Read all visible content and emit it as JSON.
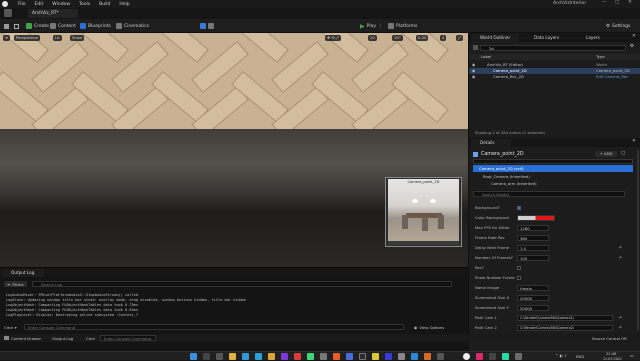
{
  "titlebar": {
    "menu": [
      "File",
      "Edit",
      "Window",
      "Tools",
      "Build",
      "Help"
    ],
    "project": "ArchVizInterior",
    "doc_tab": "ArchViz_RT*"
  },
  "toolbar": {
    "create": "Create",
    "content": "Content",
    "blueprints": "Blueprints",
    "cinematics": "Cinematics",
    "play": "Play",
    "platforms": "Platforms",
    "settings": "Settings"
  },
  "viewport": {
    "perspective": "Perspective",
    "lit": "Lit",
    "show": "Show",
    "grid_snap": "10",
    "rot_snap": "10°",
    "scale_snap": "0.25",
    "cam_speed": "4",
    "preview_label": "Camera_point_2D"
  },
  "outliner": {
    "tab_label": "World Outliner",
    "tab_data_layers": "Data Layers",
    "tab_layers": "Layers",
    "search_value": "2d",
    "col_label": "Label",
    "col_type": "Type",
    "rows": [
      {
        "label": "ArchViz_RT (Editor)",
        "type": "World"
      },
      {
        "label": "Camera_point_2D",
        "type": "Camera_point_2D"
      },
      {
        "label": "Camera_Rec_2D",
        "type": "Edit Camera_Rec"
      }
    ],
    "status": "Showing 2 of 284 actors (1 selected)"
  },
  "details": {
    "tab": "Details",
    "object_name": "Camera_point_2D",
    "add_label": "+ ADD",
    "self_row": "Camera_point_2D (self)",
    "root_component": "Root_Camera (Inherited)",
    "arm_component": "Camera_arm (Inherited)",
    "search_placeholder": "Search Details",
    "props": [
      {
        "label": "Background?",
        "value": ""
      },
      {
        "label": "Color Background",
        "value": ""
      },
      {
        "label": "Max FPS for Editor",
        "value": "1260"
      },
      {
        "label": "Frame Rate Rec",
        "value": "360"
      },
      {
        "label": "Delay Next Frame",
        "value": "1.0"
      },
      {
        "label": "Number Of Frames?",
        "value": "100"
      },
      {
        "label": "Rec?",
        "value": ""
      },
      {
        "label": "Show Number Frame",
        "value": ""
      },
      {
        "label": "Name Image",
        "value": "Vmain"
      },
      {
        "label": "Screenshot Size X",
        "value": "20000"
      },
      {
        "label": "Screenshot Size Y",
        "value": "20000"
      },
      {
        "label": "Path Cam 1",
        "value": "C:\\Render\\Camera360\\Camera1\\"
      },
      {
        "label": "Path Cam 2",
        "value": "C:\\Render\\Camera360\\Camera2\\"
      }
    ]
  },
  "outputlog": {
    "tab": "Output Log",
    "filters": "Filters",
    "search_placeholder": "Search Log",
    "lines": [
      "LogAudioMixer: FMixerPlatformAudio2::StopAudioStream() called",
      "LogSlate: Updating window title bar state: overlay mode, drag disabled, window buttons hidden, title bar hidden",
      "LogObjectHash: Compacting FUObjectHashTables data took   0.75ms",
      "LogObjectHash: Compacting FUObjectHashTables data took   0.62ms",
      "LogPlayLevel: Display: Destroying online subsystem :Context_7"
    ],
    "cmd_label": "Cmd",
    "cmd_placeholder": "Enter Console Command",
    "view_options": "View Options"
  },
  "statusbar": {
    "content_drawer": "Content Drawer",
    "output_log": "Output Log",
    "cmd": "Cmd",
    "console_placeholder": "Enter Console Command",
    "source_control": "Source Control Off"
  },
  "taskbar": {
    "lang": "ENG",
    "time": "22:46",
    "date": "11.03.2022"
  },
  "colors": {
    "accent_blue": "#2a6fd6",
    "play_green": "#3fa44a",
    "selection": "#2a3f5c",
    "color_background_swatch": "#e01919"
  }
}
